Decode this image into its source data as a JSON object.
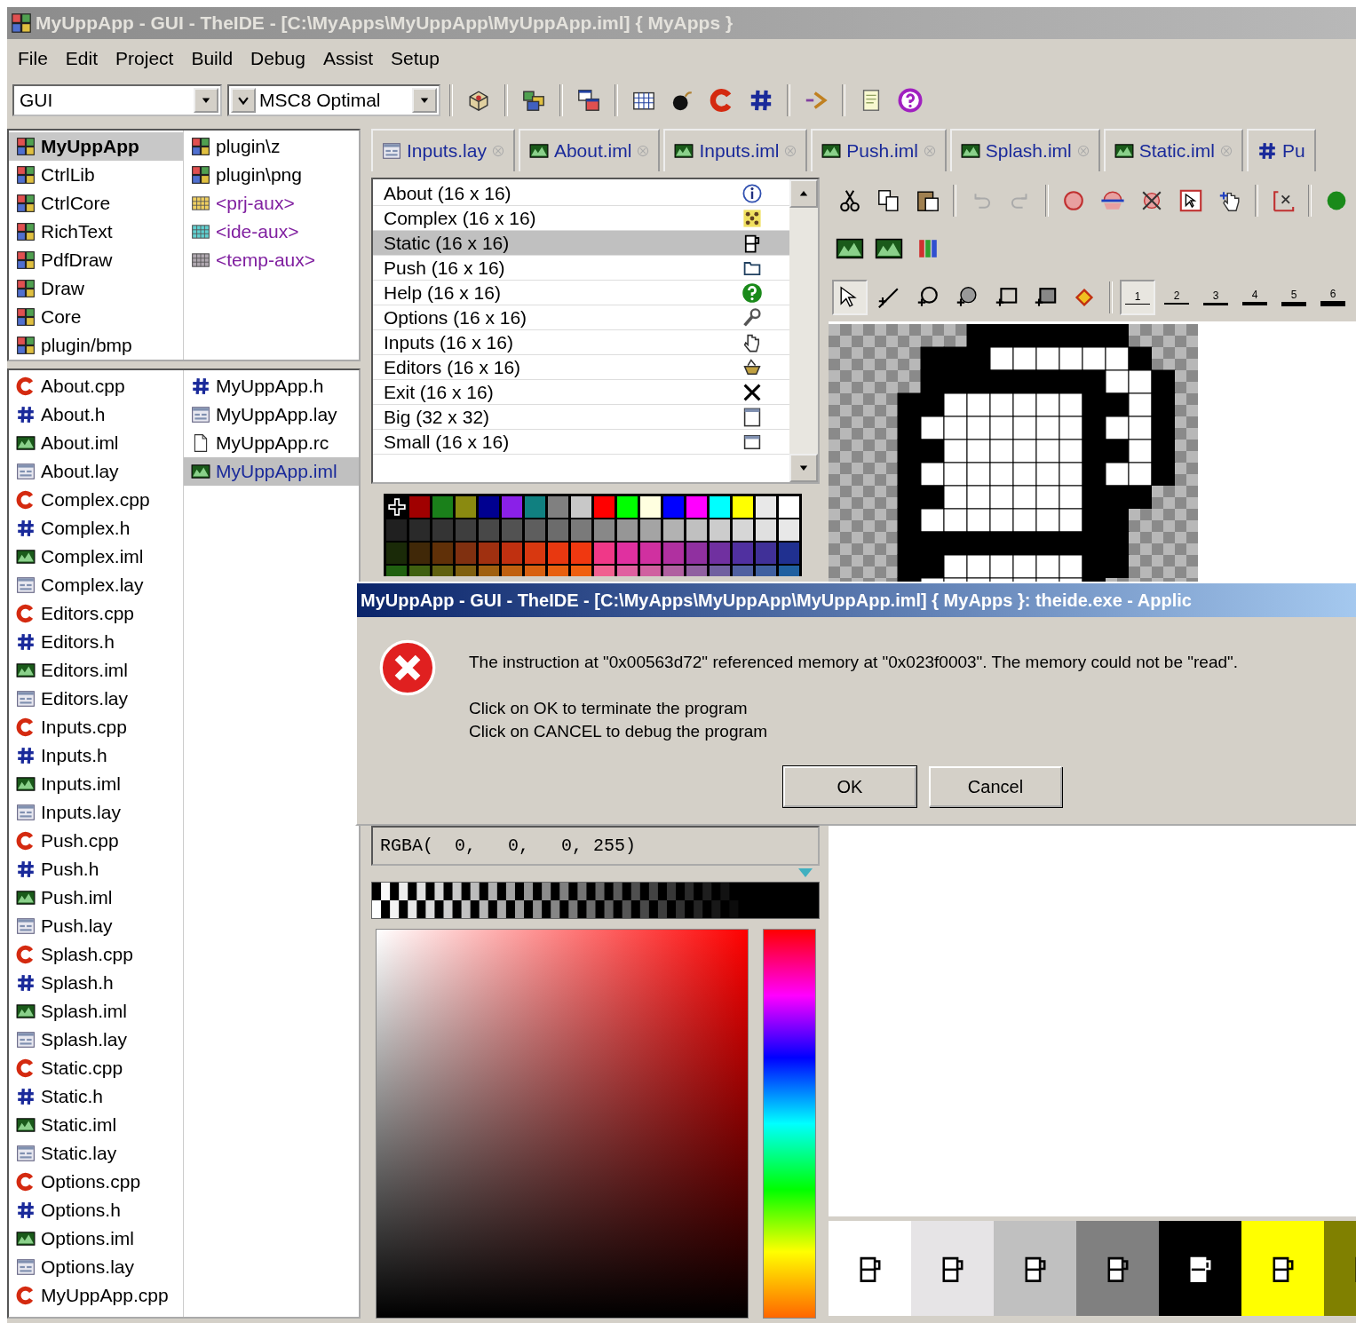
{
  "window": {
    "title": "MyUppApp - GUI - TheIDE - [C:\\MyApps\\MyUppApp\\MyUppApp.iml] { MyApps }"
  },
  "menu": [
    "File",
    "Edit",
    "Project",
    "Build",
    "Debug",
    "Assist",
    "Setup"
  ],
  "toolbar": {
    "main_package": "GUI",
    "build_method": "MSC8 Optimal"
  },
  "packages": [
    {
      "items": [
        {
          "label": "MyUppApp",
          "kind": "package",
          "selected": true
        },
        {
          "label": "CtrlLib",
          "kind": "package",
          "selected": false
        },
        {
          "label": "CtrlCore",
          "kind": "package",
          "selected": false
        },
        {
          "label": "RichText",
          "kind": "package",
          "selected": false
        },
        {
          "label": "PdfDraw",
          "kind": "package",
          "selected": false
        },
        {
          "label": "Draw",
          "kind": "package",
          "selected": false
        },
        {
          "label": "Core",
          "kind": "package",
          "selected": false
        },
        {
          "label": "plugin/bmp",
          "kind": "package",
          "selected": false
        }
      ]
    },
    {
      "items": [
        {
          "label": "plugin\\z",
          "kind": "package",
          "selected": false
        },
        {
          "label": "plugin\\png",
          "kind": "package",
          "selected": false
        },
        {
          "label": "<prj-aux>",
          "kind": "aux",
          "color": "#f0d060",
          "selected": false
        },
        {
          "label": "<ide-aux>",
          "kind": "aux",
          "color": "#60d0d0",
          "selected": false
        },
        {
          "label": "<temp-aux>",
          "kind": "aux",
          "color": "#b0a8b0",
          "selected": false
        }
      ]
    }
  ],
  "files": [
    {
      "items": [
        {
          "label": "About.cpp",
          "kind": "cpp",
          "selected": false
        },
        {
          "label": "About.h",
          "kind": "h",
          "selected": false
        },
        {
          "label": "About.iml",
          "kind": "iml",
          "selected": false
        },
        {
          "label": "About.lay",
          "kind": "lay",
          "selected": false
        },
        {
          "label": "Complex.cpp",
          "kind": "cpp",
          "selected": false
        },
        {
          "label": "Complex.h",
          "kind": "h",
          "selected": false
        },
        {
          "label": "Complex.iml",
          "kind": "iml",
          "selected": false
        },
        {
          "label": "Complex.lay",
          "kind": "lay",
          "selected": false
        },
        {
          "label": "Editors.cpp",
          "kind": "cpp",
          "selected": false
        },
        {
          "label": "Editors.h",
          "kind": "h",
          "selected": false
        },
        {
          "label": "Editors.iml",
          "kind": "iml",
          "selected": false
        },
        {
          "label": "Editors.lay",
          "kind": "lay",
          "selected": false
        },
        {
          "label": "Inputs.cpp",
          "kind": "cpp",
          "selected": false
        },
        {
          "label": "Inputs.h",
          "kind": "h",
          "selected": false
        },
        {
          "label": "Inputs.iml",
          "kind": "iml",
          "selected": false
        },
        {
          "label": "Inputs.lay",
          "kind": "lay",
          "selected": false
        },
        {
          "label": "Push.cpp",
          "kind": "cpp",
          "selected": false
        },
        {
          "label": "Push.h",
          "kind": "h",
          "selected": false
        },
        {
          "label": "Push.iml",
          "kind": "iml",
          "selected": false
        },
        {
          "label": "Push.lay",
          "kind": "lay",
          "selected": false
        },
        {
          "label": "Splash.cpp",
          "kind": "cpp",
          "selected": false
        },
        {
          "label": "Splash.h",
          "kind": "h",
          "selected": false
        },
        {
          "label": "Splash.iml",
          "kind": "iml",
          "selected": false
        },
        {
          "label": "Splash.lay",
          "kind": "lay",
          "selected": false
        },
        {
          "label": "Static.cpp",
          "kind": "cpp",
          "selected": false
        },
        {
          "label": "Static.h",
          "kind": "h",
          "selected": false
        },
        {
          "label": "Static.iml",
          "kind": "iml",
          "selected": false
        },
        {
          "label": "Static.lay",
          "kind": "lay",
          "selected": false
        },
        {
          "label": "Options.cpp",
          "kind": "cpp",
          "selected": false
        },
        {
          "label": "Options.h",
          "kind": "h",
          "selected": false
        },
        {
          "label": "Options.iml",
          "kind": "iml",
          "selected": false
        },
        {
          "label": "Options.lay",
          "kind": "lay",
          "selected": false
        },
        {
          "label": "MyUppApp.cpp",
          "kind": "cpp",
          "selected": false
        }
      ]
    },
    {
      "items": [
        {
          "label": "MyUppApp.h",
          "kind": "h",
          "selected": false
        },
        {
          "label": "MyUppApp.lay",
          "kind": "lay",
          "selected": false
        },
        {
          "label": "MyUppApp.rc",
          "kind": "rc",
          "selected": false
        },
        {
          "label": "MyUppApp.iml",
          "kind": "iml",
          "selected": true
        }
      ]
    }
  ],
  "tabs": [
    {
      "label": "Inputs.lay",
      "kind": "lay",
      "closable": true
    },
    {
      "label": "About.iml",
      "kind": "iml",
      "closable": true
    },
    {
      "label": "Inputs.iml",
      "kind": "iml",
      "closable": true
    },
    {
      "label": "Push.iml",
      "kind": "iml",
      "closable": true
    },
    {
      "label": "Splash.iml",
      "kind": "iml",
      "closable": true
    },
    {
      "label": "Static.iml",
      "kind": "iml",
      "closable": true
    },
    {
      "label": "Pu",
      "kind": "h",
      "closable": false
    }
  ],
  "images": [
    {
      "label": "About (16 x 16)",
      "selected": false
    },
    {
      "label": "Complex (16 x 16)",
      "selected": false
    },
    {
      "label": "Static (16 x 16)",
      "selected": true
    },
    {
      "label": "Push (16 x 16)",
      "selected": false
    },
    {
      "label": "Help (16 x 16)",
      "selected": false
    },
    {
      "label": "Options (16 x 16)",
      "selected": false
    },
    {
      "label": "Inputs (16 x 16)",
      "selected": false
    },
    {
      "label": "Editors (16 x 16)",
      "selected": false
    },
    {
      "label": "Exit (16 x 16)",
      "selected": false
    },
    {
      "label": "Big (32 x 32)",
      "selected": false
    },
    {
      "label": "Small (16 x 16)",
      "selected": false
    }
  ],
  "palette": [
    {
      "cells": [
        {
          "color": "#000000",
          "selected": true
        },
        {
          "color": "#a00000",
          "selected": false
        },
        {
          "color": "#1a801a",
          "selected": false
        },
        {
          "color": "#8a8a10",
          "selected": false
        },
        {
          "color": "#000090",
          "selected": false
        },
        {
          "color": "#8a20e8",
          "selected": false
        },
        {
          "color": "#108080",
          "selected": false
        },
        {
          "color": "#808080",
          "selected": false
        },
        {
          "color": "#c8c8c8",
          "selected": false
        },
        {
          "color": "#ff0000",
          "selected": false
        },
        {
          "color": "#00ff00",
          "selected": false
        },
        {
          "color": "#ffffe0",
          "selected": false
        },
        {
          "color": "#0000ff",
          "selected": false
        },
        {
          "color": "#ff00ff",
          "selected": false
        },
        {
          "color": "#00ffff",
          "selected": false
        },
        {
          "color": "#ffff00",
          "selected": false
        },
        {
          "color": "#e8e8e8",
          "selected": false
        },
        {
          "color": "#ffffff",
          "selected": false
        }
      ]
    },
    {
      "cells": [
        {
          "color": "#202020",
          "selected": false
        },
        {
          "color": "#2a2a2a",
          "selected": false
        },
        {
          "color": "#343434",
          "selected": false
        },
        {
          "color": "#3e3e3e",
          "selected": false
        },
        {
          "color": "#484848",
          "selected": false
        },
        {
          "color": "#525252",
          "selected": false
        },
        {
          "color": "#5e5e5e",
          "selected": false
        },
        {
          "color": "#6c6c6c",
          "selected": false
        },
        {
          "color": "#7a7a7a",
          "selected": false
        },
        {
          "color": "#888888",
          "selected": false
        },
        {
          "color": "#969696",
          "selected": false
        },
        {
          "color": "#a4a4a4",
          "selected": false
        },
        {
          "color": "#b2b2b2",
          "selected": false
        },
        {
          "color": "#c0c0c0",
          "selected": false
        },
        {
          "color": "#cccccc",
          "selected": false
        },
        {
          "color": "#d6d6d6",
          "selected": false
        },
        {
          "color": "#e0e0e0",
          "selected": false
        },
        {
          "color": "#e8e8e8",
          "selected": false
        }
      ]
    },
    {
      "cells": [
        {
          "color": "#1a2a08",
          "selected": false
        },
        {
          "color": "#402808",
          "selected": false
        },
        {
          "color": "#603008",
          "selected": false
        },
        {
          "color": "#803010",
          "selected": false
        },
        {
          "color": "#a03010",
          "selected": false
        },
        {
          "color": "#c03010",
          "selected": false
        },
        {
          "color": "#d83810",
          "selected": false
        },
        {
          "color": "#e83810",
          "selected": false
        },
        {
          "color": "#f03810",
          "selected": false
        },
        {
          "color": "#f03888",
          "selected": false
        },
        {
          "color": "#e030a0",
          "selected": false
        },
        {
          "color": "#d030a0",
          "selected": false
        },
        {
          "color": "#b030a0",
          "selected": false
        },
        {
          "color": "#9030a0",
          "selected": false
        },
        {
          "color": "#7030a0",
          "selected": false
        },
        {
          "color": "#5030a0",
          "selected": false
        },
        {
          "color": "#403098",
          "selected": false
        },
        {
          "color": "#203090",
          "selected": false
        }
      ]
    },
    {
      "cells": [
        {
          "color": "#206010",
          "selected": false
        },
        {
          "color": "#406010",
          "selected": false
        },
        {
          "color": "#606010",
          "selected": false
        },
        {
          "color": "#806010",
          "selected": false
        },
        {
          "color": "#a06010",
          "selected": false
        },
        {
          "color": "#c06010",
          "selected": false
        },
        {
          "color": "#d86010",
          "selected": false
        },
        {
          "color": "#e86010",
          "selected": false
        },
        {
          "color": "#f06010",
          "selected": false
        },
        {
          "color": "#f06090",
          "selected": false
        },
        {
          "color": "#e060a0",
          "selected": false
        },
        {
          "color": "#d060a0",
          "selected": false
        },
        {
          "color": "#b060a0",
          "selected": false
        },
        {
          "color": "#9060a0",
          "selected": false
        },
        {
          "color": "#7060a0",
          "selected": false
        },
        {
          "color": "#5060a0",
          "selected": false
        },
        {
          "color": "#4060a0",
          "selected": false
        },
        {
          "color": "#2060a0",
          "selected": false
        }
      ]
    }
  ],
  "pixel_color": {
    "value": "RGBA(  0,   0,   0, 255)"
  },
  "alpha": {
    "level": 0.97
  },
  "tools": [
    {
      "selected": true
    },
    {
      "selected": false
    },
    {
      "selected": false
    },
    {
      "selected": false
    },
    {
      "selected": false
    },
    {
      "selected": false
    },
    {
      "selected": false
    }
  ],
  "line_widths": [
    {
      "label": "1",
      "selected": true
    },
    {
      "label": "2",
      "selected": false
    },
    {
      "label": "3",
      "selected": false
    },
    {
      "label": "4",
      "selected": false
    },
    {
      "label": "5",
      "selected": false
    },
    {
      "label": "6",
      "selected": false
    }
  ],
  "backgrounds": [
    {
      "color": "#ffffff"
    },
    {
      "color": "#e6e4e6"
    },
    {
      "color": "#c0c0c0"
    },
    {
      "color": "#808080"
    },
    {
      "color": "#000000"
    },
    {
      "color": "#ffff00"
    },
    {
      "color": "#808000"
    }
  ],
  "dialog": {
    "title": "MyUppApp - GUI - TheIDE - [C:\\MyApps\\MyUppApp\\MyUppApp.iml] { MyApps }: theide.exe - Applic",
    "message": "The instruction at \"0x00563d72\" referenced memory at \"0x023f0003\". The memory could not be \"read\".",
    "lines": [
      "Click on OK to terminate the program",
      "Click on CANCEL to debug the program"
    ],
    "buttons": [
      "OK",
      "Cancel"
    ]
  }
}
